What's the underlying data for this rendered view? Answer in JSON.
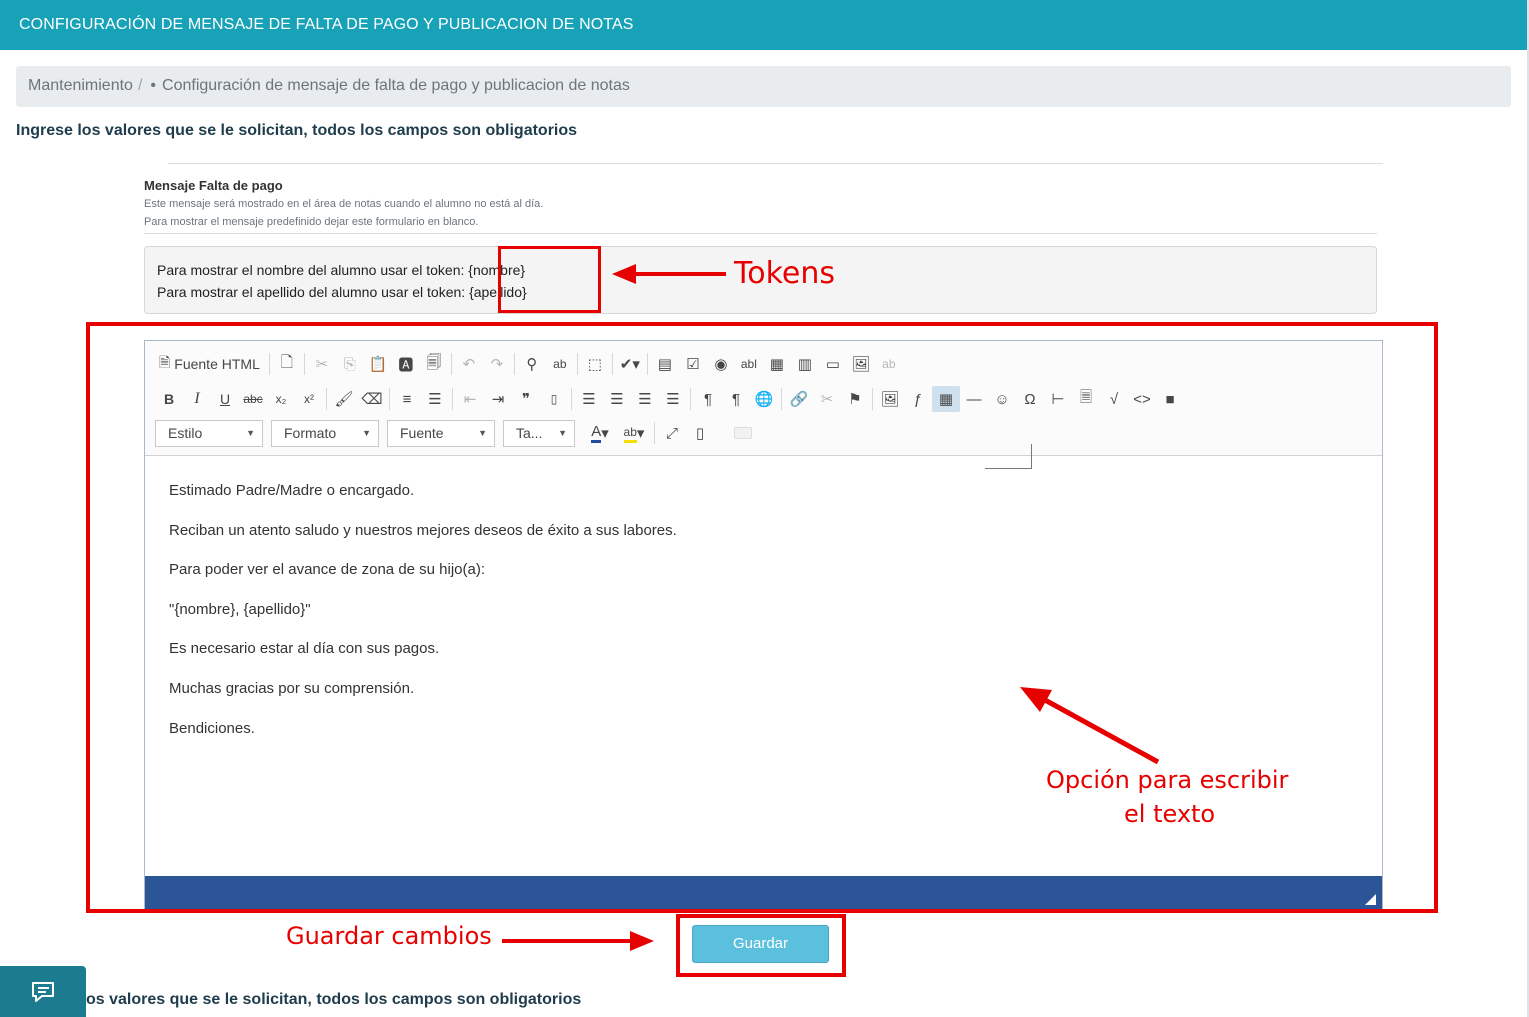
{
  "header": {
    "title": "CONFIGURACIÓN DE MENSAJE DE FALTA DE PAGO Y PUBLICACION DE NOTAS"
  },
  "breadcrumb": {
    "root": "Mantenimiento",
    "separator": "/",
    "bullet": "•",
    "current": "Configuración de mensaje de falta de pago y publicacion de notas"
  },
  "instructions": "Ingrese los valores que se le solicitan, todos los campos son obligatorios",
  "instructions_bottom_visible": "os valores que se le solicitan, todos los campos son obligatorios",
  "field": {
    "title": "Mensaje Falta de pago",
    "help_line1": "Este mensaje será mostrado en el área de notas cuando el alumno no está al día.",
    "help_line2": "Para mostrar el mensaje predefinido dejar este formulario en blanco."
  },
  "tokens": {
    "line1_text": "Para mostrar el nombre del alumno usar el token: ",
    "line1_token": "{nombre}",
    "line2_text": "Para mostrar el apellido del alumno usar el token: ",
    "line2_token": "{apellido}"
  },
  "toolbar": {
    "source_label": "Fuente HTML",
    "bold": "B",
    "italic": "I",
    "underline": "U",
    "strike": "abc",
    "subscript": "x₂",
    "superscript": "x²",
    "combos": [
      {
        "label": "Estilo"
      },
      {
        "label": "Formato"
      },
      {
        "label": "Fuente"
      },
      {
        "label": "Ta..."
      }
    ]
  },
  "editor": {
    "paragraphs": [
      "Estimado Padre/Madre o encargado.",
      "Reciban un atento saludo y nuestros mejores deseos de éxito a sus labores.",
      "Para poder ver el avance de zona de su hijo(a):",
      "\"{nombre}, {apellido}\"",
      "Es necesario estar al día con sus pagos.",
      "Muchas gracias por su comprensión.",
      "Bendiciones."
    ]
  },
  "save_button": {
    "label": "Guardar"
  },
  "annotations": {
    "tokens_label": "Tokens",
    "editor_label_line1": "Opción para escribir",
    "editor_label_line2": "el texto",
    "save_label": "Guardar cambios",
    "color": "#e60000"
  },
  "colors": {
    "header": "#17a2b8",
    "save_button": "#5bc0de",
    "editor_footer": "#2c5597",
    "chat_widget": "#1d7b8f"
  }
}
